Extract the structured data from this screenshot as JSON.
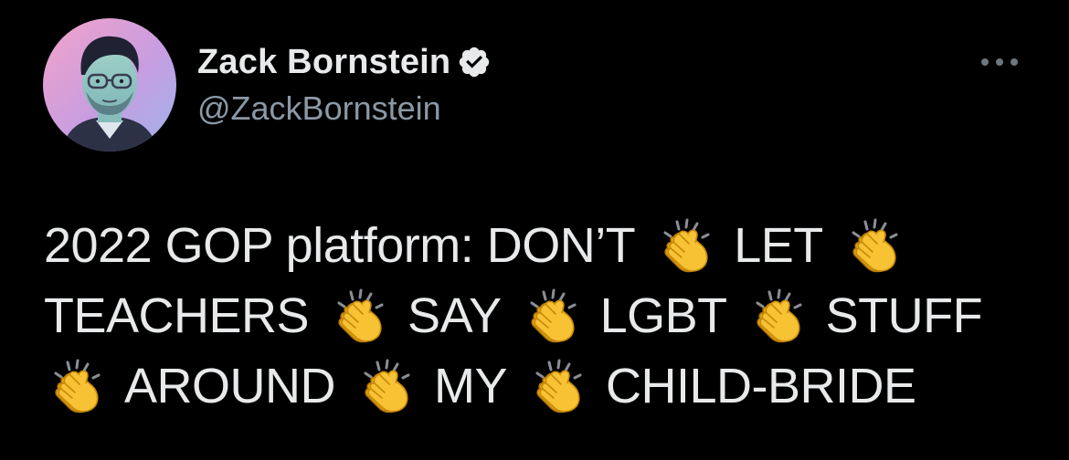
{
  "author": {
    "display_name": "Zack Bornstein",
    "handle": "@ZackBornstein",
    "verified": true,
    "avatar": "avatar"
  },
  "icons": {
    "verified": "verified-badge-icon",
    "more": "more-options-icon",
    "clap": "clapping-hands-emoji"
  },
  "tweet": {
    "lines": [
      [
        "2022 GOP platform: DON’T",
        "clap",
        "LET",
        "clap"
      ],
      [
        "TEACHERS",
        "clap",
        "SAY",
        "clap",
        "LGBT",
        "clap",
        "STUFF"
      ],
      [
        "clap",
        "AROUND",
        "clap",
        "MY",
        "clap",
        "CHILD-BRIDE"
      ]
    ],
    "text": {
      "l1_w1": "2022 GOP platform: DON’T",
      "l1_w2": "LET",
      "l2_w1": "TEACHERS",
      "l2_w2": "SAY",
      "l2_w3": "LGBT",
      "l2_w4": "STUFF",
      "l3_w1": "AROUND",
      "l3_w2": "MY",
      "l3_w3": "CHILD-BRIDE"
    }
  },
  "colors": {
    "background": "#000000",
    "primary_text": "#e7e9ea",
    "secondary_text": "#8b98a5",
    "verified_badge": "#e7e9ea",
    "clap_yellow": "#f7c234"
  }
}
